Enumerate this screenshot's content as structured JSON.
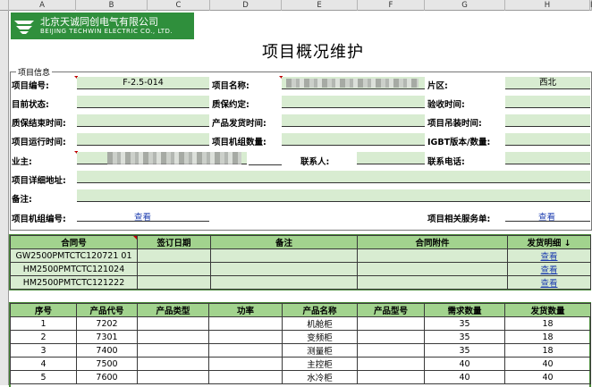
{
  "spreadsheet": {
    "columns": [
      {
        "letter": "A"
      },
      {
        "letter": "B"
      },
      {
        "letter": "C"
      },
      {
        "letter": "D"
      },
      {
        "letter": "E"
      },
      {
        "letter": "F"
      },
      {
        "letter": "G"
      },
      {
        "letter": "H"
      },
      {
        "letter": "I"
      }
    ]
  },
  "logo": {
    "name_cn": "北京天诚同创电气有限公司",
    "name_en": "BEIJING TECHWIN ELECTRIC CO., LTD."
  },
  "page": {
    "title": "项目概况维护"
  },
  "project_info": {
    "legend": "项目信息",
    "labels": {
      "project_no": "项目编号:",
      "project_name": "项目名称:",
      "region": "片区:",
      "current_status": "目前状态:",
      "warranty_terms": "质保约定:",
      "acceptance_time": "验收时间:",
      "warranty_end": "质保结束时间:",
      "ship_time": "产品发货时间:",
      "hoist_time": "项目吊装时间:",
      "run_time": "项目运行时间:",
      "unit_count": "项目机组数量:",
      "igbt": "IGBT版本/数量:",
      "owner": "业主:",
      "contact": "联系人:",
      "phone": "联系电话:",
      "address": "项目详细地址:",
      "notes": "备注:",
      "unit_no": "项目机组编号:",
      "service_list": "项目相关服务单:"
    },
    "values": {
      "project_no": "F-2.5-014",
      "region": "西北"
    },
    "view_label": "查看"
  },
  "contracts": {
    "headers": [
      "合同号",
      "签订日期",
      "备注",
      "合同附件",
      "发货明细 ↓"
    ],
    "rows": [
      {
        "no": "GW2500PMTCTC120721 01",
        "date": "",
        "remark": "",
        "attach": "",
        "detail": "查看"
      },
      {
        "no": "HM2500PMTCTC121024",
        "date": "",
        "remark": "",
        "attach": "",
        "detail": "查看"
      },
      {
        "no": "HM2500PMTCTC121222",
        "date": "",
        "remark": "",
        "attach": "",
        "detail": "查看"
      }
    ]
  },
  "products": {
    "headers": [
      "序号",
      "产品代号",
      "产品类型",
      "功率",
      "产品名称",
      "产品型号",
      "需求数量",
      "发货数量"
    ],
    "rows": [
      {
        "seq": "1",
        "code": "7202",
        "type": "",
        "power": "",
        "name": "机舱柜",
        "model": "",
        "demand": "35",
        "shipped": "18"
      },
      {
        "seq": "2",
        "code": "7301",
        "type": "",
        "power": "",
        "name": "变频柜",
        "model": "",
        "demand": "35",
        "shipped": "18"
      },
      {
        "seq": "3",
        "code": "7400",
        "type": "",
        "power": "",
        "name": "测量柜",
        "model": "",
        "demand": "35",
        "shipped": "18"
      },
      {
        "seq": "4",
        "code": "7500",
        "type": "",
        "power": "",
        "name": "主控柜",
        "model": "",
        "demand": "40",
        "shipped": "40"
      },
      {
        "seq": "5",
        "code": "7600",
        "type": "",
        "power": "",
        "name": "水冷柜",
        "model": "",
        "demand": "40",
        "shipped": "40"
      }
    ]
  }
}
